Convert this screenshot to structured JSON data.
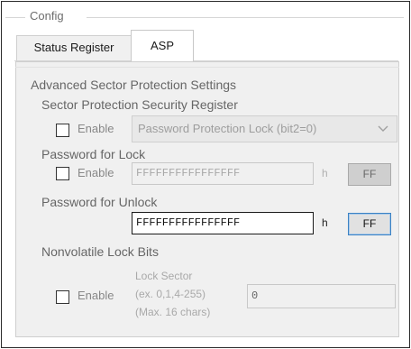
{
  "group": {
    "legend": "Config"
  },
  "tabs": [
    {
      "label": "Status Register",
      "active": false
    },
    {
      "label": "ASP",
      "active": true
    }
  ],
  "asp": {
    "section_title": "Advanced Sector Protection Settings",
    "sector_protection": {
      "label": "Sector Protection Security Register",
      "enable_label": "Enable",
      "enabled": false,
      "select_value": "Password Protection Lock (bit2=0)"
    },
    "password_lock": {
      "label": "Password for Lock",
      "enable_label": "Enable",
      "enabled": false,
      "value": "FFFFFFFFFFFFFFFF",
      "unit": "h",
      "button_label": "FF"
    },
    "password_unlock": {
      "label": "Password for Unlock",
      "value": "FFFFFFFFFFFFFFFF",
      "unit": "h",
      "button_label": "FF"
    },
    "nonvolatile": {
      "label": "Nonvolatile Lock Bits",
      "enable_label": "Enable",
      "enabled": false,
      "lock_sector_label": "Lock Sector",
      "example_label": "(ex. 0,1,4-255)",
      "max_label": "(Max. 16 chars)",
      "value": "0"
    }
  },
  "colors": {
    "panel_bg": "#f0f0f0",
    "disabled_text": "#a8a8a8",
    "accent_border": "#3b82c4"
  }
}
